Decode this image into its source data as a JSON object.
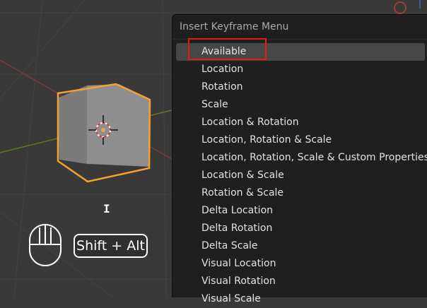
{
  "menu": {
    "title": "Insert Keyframe Menu",
    "items": [
      {
        "label": "Available",
        "active": true
      },
      {
        "label": "Location"
      },
      {
        "label": "Rotation"
      },
      {
        "label": "Scale"
      },
      {
        "label": "Location & Rotation"
      },
      {
        "label": "Location, Rotation & Scale"
      },
      {
        "label": "Location, Rotation, Scale & Custom Properties"
      },
      {
        "label": "Location & Scale"
      },
      {
        "label": "Rotation & Scale"
      },
      {
        "label": "Delta Location"
      },
      {
        "label": "Delta Rotation"
      },
      {
        "label": "Delta Scale"
      },
      {
        "label": "Visual Location"
      },
      {
        "label": "Visual Rotation"
      },
      {
        "label": "Visual Scale"
      }
    ]
  },
  "overlay": {
    "shortcut": "Shift + Alt",
    "cursor_glyph": "I"
  },
  "colors": {
    "viewport_bg": "#393939",
    "selection_outline": "#f5a030",
    "highlight": "#e01a1a",
    "menu_bg": "#1f1f1f"
  }
}
